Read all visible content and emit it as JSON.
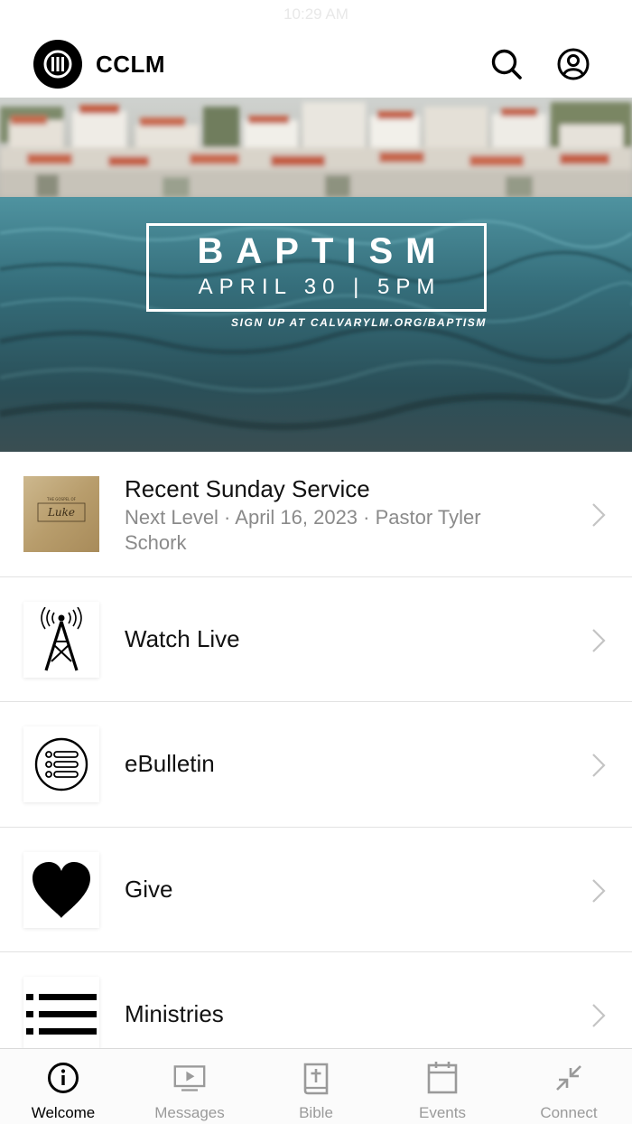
{
  "status": {
    "time": "10:29 AM"
  },
  "header": {
    "title": "CCLM"
  },
  "hero": {
    "title": "BAPTISM",
    "date": "APRIL 30  |  5PM",
    "signup": "SIGN UP AT CALVARYLM.ORG/BAPTISM"
  },
  "menu": [
    {
      "label": "Recent Sunday Service",
      "subtitle": "Next Level · April 16, 2023 · Pastor Tyler Schork",
      "icon": "sermon-thumbnail"
    },
    {
      "label": "Watch Live",
      "icon": "broadcast-tower-icon"
    },
    {
      "label": "eBulletin",
      "icon": "list-circle-icon"
    },
    {
      "label": "Give",
      "icon": "heart-icon"
    },
    {
      "label": "Ministries",
      "icon": "list-icon"
    }
  ],
  "tabs": [
    {
      "label": "Welcome",
      "icon": "info-icon",
      "active": true
    },
    {
      "label": "Messages",
      "icon": "video-icon",
      "active": false
    },
    {
      "label": "Bible",
      "icon": "bible-icon",
      "active": false
    },
    {
      "label": "Events",
      "icon": "calendar-icon",
      "active": false
    },
    {
      "label": "Connect",
      "icon": "connect-icon",
      "active": false
    }
  ],
  "colors": {
    "accent": "#000000",
    "inactive": "#9a9a9a",
    "water": "#2f5b66"
  }
}
